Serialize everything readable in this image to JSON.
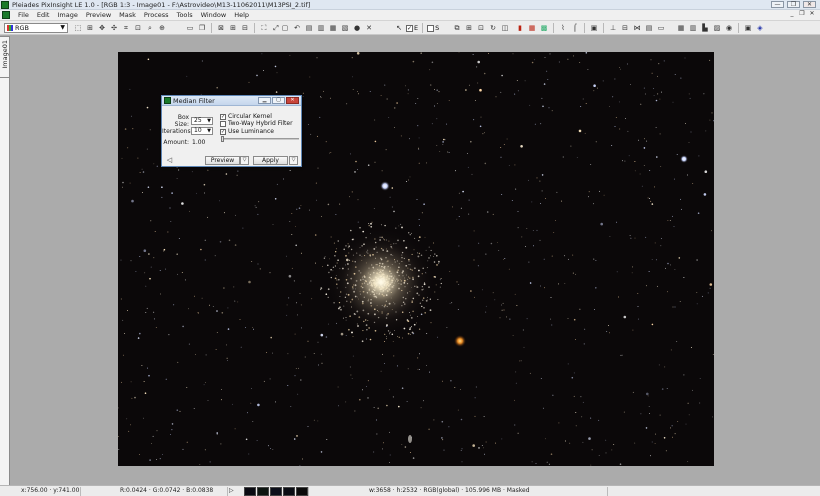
{
  "window": {
    "title": "Pleiades PixInsight LE 1.0 - [RGB 1:3 - Image01 - F:\\Astrovideo\\M13-11062011\\M13PSI_2.tif]",
    "minimize": "—",
    "restore": "❐",
    "close": "✕"
  },
  "menu": {
    "items": [
      "File",
      "Edit",
      "Image",
      "Preview",
      "Mask",
      "Process",
      "Tools",
      "Window",
      "Help"
    ],
    "mdi_minimize": "_",
    "mdi_restore": "❐",
    "mdi_close": "✕"
  },
  "toolbar": {
    "color_mode": "RGB",
    "check_e_label": "E",
    "check_s_label": "S",
    "check_e_checked": "✓",
    "check_s_checked": ""
  },
  "side_tab": {
    "label": "Image01"
  },
  "dialog": {
    "title": "Median Filter",
    "box_size_label": "Box Size:",
    "box_size_value": "25",
    "iterations_label": "Iterations:",
    "iterations_value": "10",
    "amount_label": "Amount:",
    "amount_value": "1.00",
    "amount_level": 0.0,
    "circular_kernel": {
      "label": "Circular Kernel",
      "checked": "✓"
    },
    "two_way_hybrid": {
      "label": "Two-Way Hybrid Filter",
      "checked": ""
    },
    "use_luminance": {
      "label": "Use Luminance",
      "checked": "✓"
    },
    "preview_label": "Preview",
    "apply_label": "Apply"
  },
  "status": {
    "coords": "x:756.00 · y:741.00",
    "rgb": "R:0.0424 · G:0.0742 · B:0.0838",
    "info": "w:3658 · h:2532 · RGB(global) · 105.996 MB · Masked",
    "swatch_colors": [
      "#0a0a12",
      "#0c1410",
      "#0c0f1a",
      "#0b0d14",
      "#0a0a0a"
    ]
  }
}
